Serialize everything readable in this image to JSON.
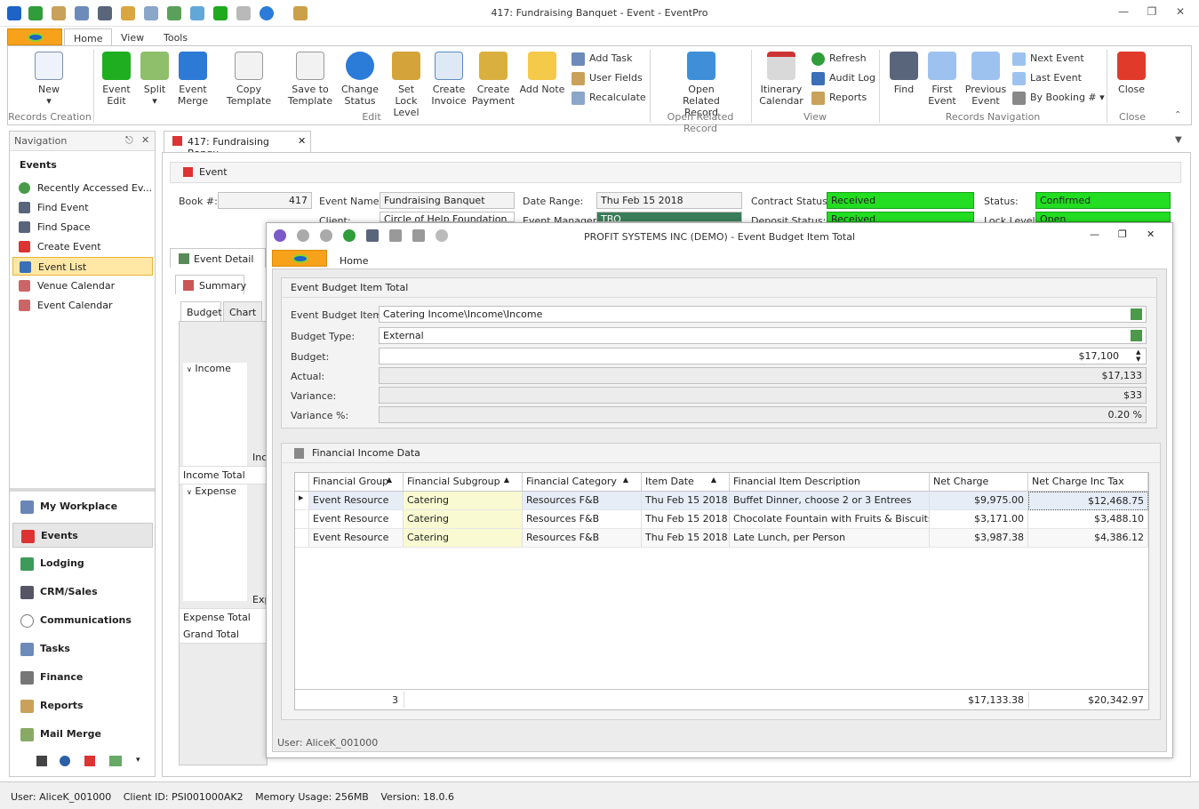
{
  "window": {
    "title": "417: Fundraising Banquet - Event - EventPro"
  },
  "tabs": [
    "Home",
    "View",
    "Tools"
  ],
  "ribbon": {
    "new": "New",
    "event_edit": "Event Edit",
    "split": "Split",
    "event_merge": "Event Merge",
    "copy_template": "Copy Template",
    "save_to_template": "Save to Template",
    "change_status": "Change Status",
    "set_lock_level": "Set Lock Level",
    "create_invoice": "Create Invoice",
    "create_payment": "Create Payment",
    "add_note": "Add Note",
    "add_task": "Add Task",
    "user_fields": "User Fields",
    "recalculate": "Recalculate",
    "open_related_record": "Open Related Record",
    "itinerary_calendar": "Itinerary Calendar",
    "refresh": "Refresh",
    "audit_log": "Audit Log",
    "reports": "Reports",
    "find": "Find",
    "first_event": "First Event",
    "previous_event": "Previous Event",
    "next_event": "Next Event",
    "last_event": "Last Event",
    "by_booking": "By Booking #",
    "close": "Close",
    "groups": {
      "records_creation": "Records Creation",
      "edit": "Edit",
      "open_related": "Open Related Record",
      "view": "View",
      "records_navigation": "Records Navigation",
      "close": "Close"
    }
  },
  "nav": {
    "header": "Navigation",
    "section": "Events",
    "items": [
      "Recently Accessed Ev...",
      "Find Event",
      "Find Space",
      "Create Event",
      "Event List",
      "Venue Calendar",
      "Event Calendar"
    ],
    "modules": [
      "My Workplace",
      "Events",
      "Lodging",
      "CRM/Sales",
      "Communications",
      "Tasks",
      "Finance",
      "Reports",
      "Mail Merge"
    ]
  },
  "doc_tab": "417: Fundraising Banqu",
  "event": {
    "panel_title": "Event",
    "book_label": "Book #:",
    "book_value": "417",
    "name_label": "Event Name:",
    "name_value": "Fundraising Banquet",
    "date_label": "Date Range:",
    "date_value": "Thu Feb 15 2018",
    "contract_label": "Contract Status:",
    "contract_value": "Received",
    "status_label": "Status:",
    "status_value": "Confirmed",
    "client_label": "Client:",
    "client_value": "Circle of Help Foundation",
    "manager_label": "Event Manager:",
    "manager_value": "TBO",
    "deposit_label": "Deposit Status:",
    "deposit_value": "Received",
    "lock_label": "Lock Level:",
    "lock_value": "Open"
  },
  "sub_tabs": {
    "event_detail": "Event Detail",
    "summary": "Summary",
    "budget": "Budget",
    "chart": "Chart"
  },
  "budget_rows": {
    "income": "Income",
    "inc": "Inc",
    "income_total": "Income Total",
    "expense": "Expense",
    "exp": "Exp",
    "expense_total": "Expense Total",
    "grand_total": "Grand Total"
  },
  "dialog": {
    "title": "PROFIT SYSTEMS INC (DEMO) - Event Budget Item Total",
    "tab": "Home",
    "panel_title": "Event Budget Item Total",
    "item_label": "Event Budget Item:",
    "item_value": "Catering Income\\Income\\Income",
    "type_label": "Budget Type:",
    "type_value": "External",
    "budget_label": "Budget:",
    "budget_value": "$17,100",
    "actual_label": "Actual:",
    "actual_value": "$17,133",
    "variance_label": "Variance:",
    "variance_value": "$33",
    "variance_pct_label": "Variance %:",
    "variance_pct_value": "0.20 %",
    "grid_title": "Financial Income Data",
    "columns": [
      "Financial Group",
      "Financial Subgroup",
      "Financial Category",
      "Item Date",
      "Financial Item Description",
      "Net Charge",
      "Net Charge Inc Tax"
    ],
    "rows": [
      {
        "group": "Event Resource",
        "subgroup": "Catering",
        "category": "Resources F&B",
        "date": "Thu Feb 15 2018",
        "desc": "Buffet Dinner, choose 2 or 3 Entrees",
        "net": "$9,975.00",
        "net_tax": "$12,468.75"
      },
      {
        "group": "Event Resource",
        "subgroup": "Catering",
        "category": "Resources F&B",
        "date": "Thu Feb 15 2018",
        "desc": "Chocolate Fountain with Fruits & Biscuits",
        "net": "$3,171.00",
        "net_tax": "$3,488.10"
      },
      {
        "group": "Event Resource",
        "subgroup": "Catering",
        "category": "Resources F&B",
        "date": "Thu Feb 15 2018",
        "desc": "Late Lunch, per Person",
        "net": "$3,987.38",
        "net_tax": "$4,386.12"
      }
    ],
    "footer": {
      "count": "3",
      "net_total": "$17,133.38",
      "net_tax_total": "$20,342.97"
    },
    "user": "User: AliceK_001000"
  },
  "status": {
    "user": "User: AliceK_001000",
    "client": "Client ID: PSI001000AK2",
    "memory": "Memory Usage: 256MB",
    "version": "Version: 18.0.6"
  },
  "colors": {
    "accent_orange": "#f7a21a",
    "status_green": "#22dd22",
    "selected_nav": "#ffe8a6"
  }
}
